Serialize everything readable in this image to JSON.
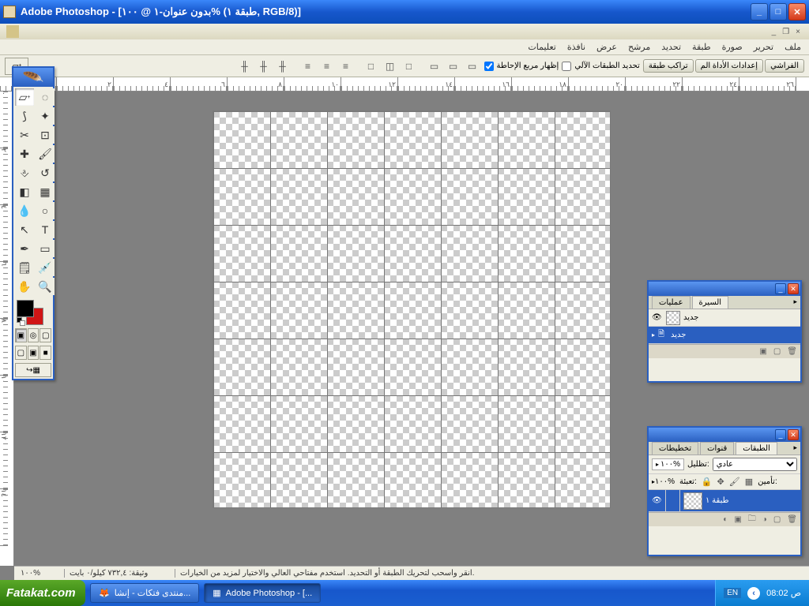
{
  "titlebar": {
    "text": "Adobe Photoshop - [بدون عنوان-١ @ ١٠٠% (طبقة ١, RGB/8)]"
  },
  "menubar": {
    "items": [
      "تعليمات",
      "نافذة",
      "عرض",
      "مرشح",
      "تحديد",
      "طبقة",
      "صورة",
      "تحرير",
      "ملف"
    ]
  },
  "options": {
    "presets": [
      "الفراشي",
      "إعدادات الأداة الم",
      "تراكب طبقة"
    ],
    "check1_label": "تحديد الطبقات الآلي",
    "check2_label": "إظهار مربع الإحاطة",
    "check1": false,
    "check2": true
  },
  "canvas_status": {
    "zoom": "١٠٠%",
    "doc_info": "وثيقة: ٧٣٢,٤ كيلو/٠ بايت",
    "hint": "انقر واسحب لتحريك الطبقة أو التحديد. استخدم مفتاحي العالي والاختيار لمزيد من الخيارات."
  },
  "history_panel": {
    "tabs": [
      "عمليات",
      "السيرة"
    ],
    "row1": "جديد",
    "row2": "جديد"
  },
  "layers_panel": {
    "tabs": [
      "تخطيطات",
      "قنوات",
      "الطبقات"
    ],
    "blend_label": "عادي",
    "opacity_label": "تظليل:",
    "opacity_val": "١٠٠%",
    "fill_label": "تعبئة:",
    "fill_val": "١٠٠%",
    "lock_label": "تأمين:",
    "layer1": "طبقة ١"
  },
  "taskbar": {
    "start": "Fatakat.com",
    "btn1": "منتدى فتكات - إنشا...",
    "btn2": "Adobe Photoshop - [...",
    "lang": "EN",
    "time": "08:02 ص"
  }
}
